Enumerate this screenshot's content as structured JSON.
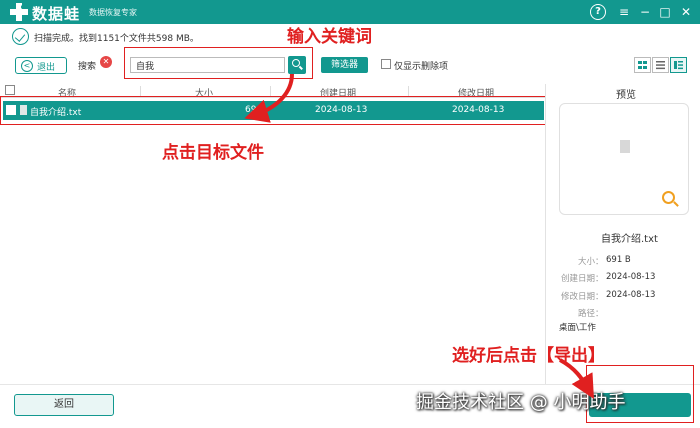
{
  "app": {
    "name": "数据蛙",
    "subtitle": "数据恢复专家",
    "brand_color": "#12988f"
  },
  "window_controls": {
    "help": "?",
    "menu": "≡",
    "minimize": "−",
    "maximize": "□",
    "close": "✕"
  },
  "scan_status": "扫描完成。找到1151个文件共598 MB。",
  "annotations": {
    "search_hint": "输入关键词",
    "click_hint": "点击目标文件",
    "export_hint": "选好后点击【导出】",
    "color": "#e02020"
  },
  "toolbar": {
    "back_label": "退出",
    "search_label": "搜索",
    "search_value": "自我",
    "filter_label": "筛选器",
    "only_deleted_label": "仅显示删除项",
    "views": [
      "grid-view-icon",
      "list-view-icon",
      "detail-view-icon"
    ],
    "active_view": 2
  },
  "table": {
    "columns": [
      "名称",
      "大小",
      "创建日期",
      "修改日期"
    ],
    "rows": [
      {
        "name": "自我介绍.txt",
        "size": "69",
        "created": "2024-08-13",
        "modified": "2024-08-13",
        "selected": true
      }
    ]
  },
  "preview": {
    "title": "预览",
    "file_name": "自我介绍.txt",
    "size_label": "大小：",
    "size_value": "691  B",
    "created_label": "创建日期：",
    "created_value": "2024-08-13",
    "modified_label": "修改日期：",
    "modified_value": "2024-08-13",
    "path_label": "路径：",
    "path_value": "桌面\\工作"
  },
  "footer": {
    "return_label": "返回",
    "watermark": "掘金技术社区 @ 小明助手"
  }
}
